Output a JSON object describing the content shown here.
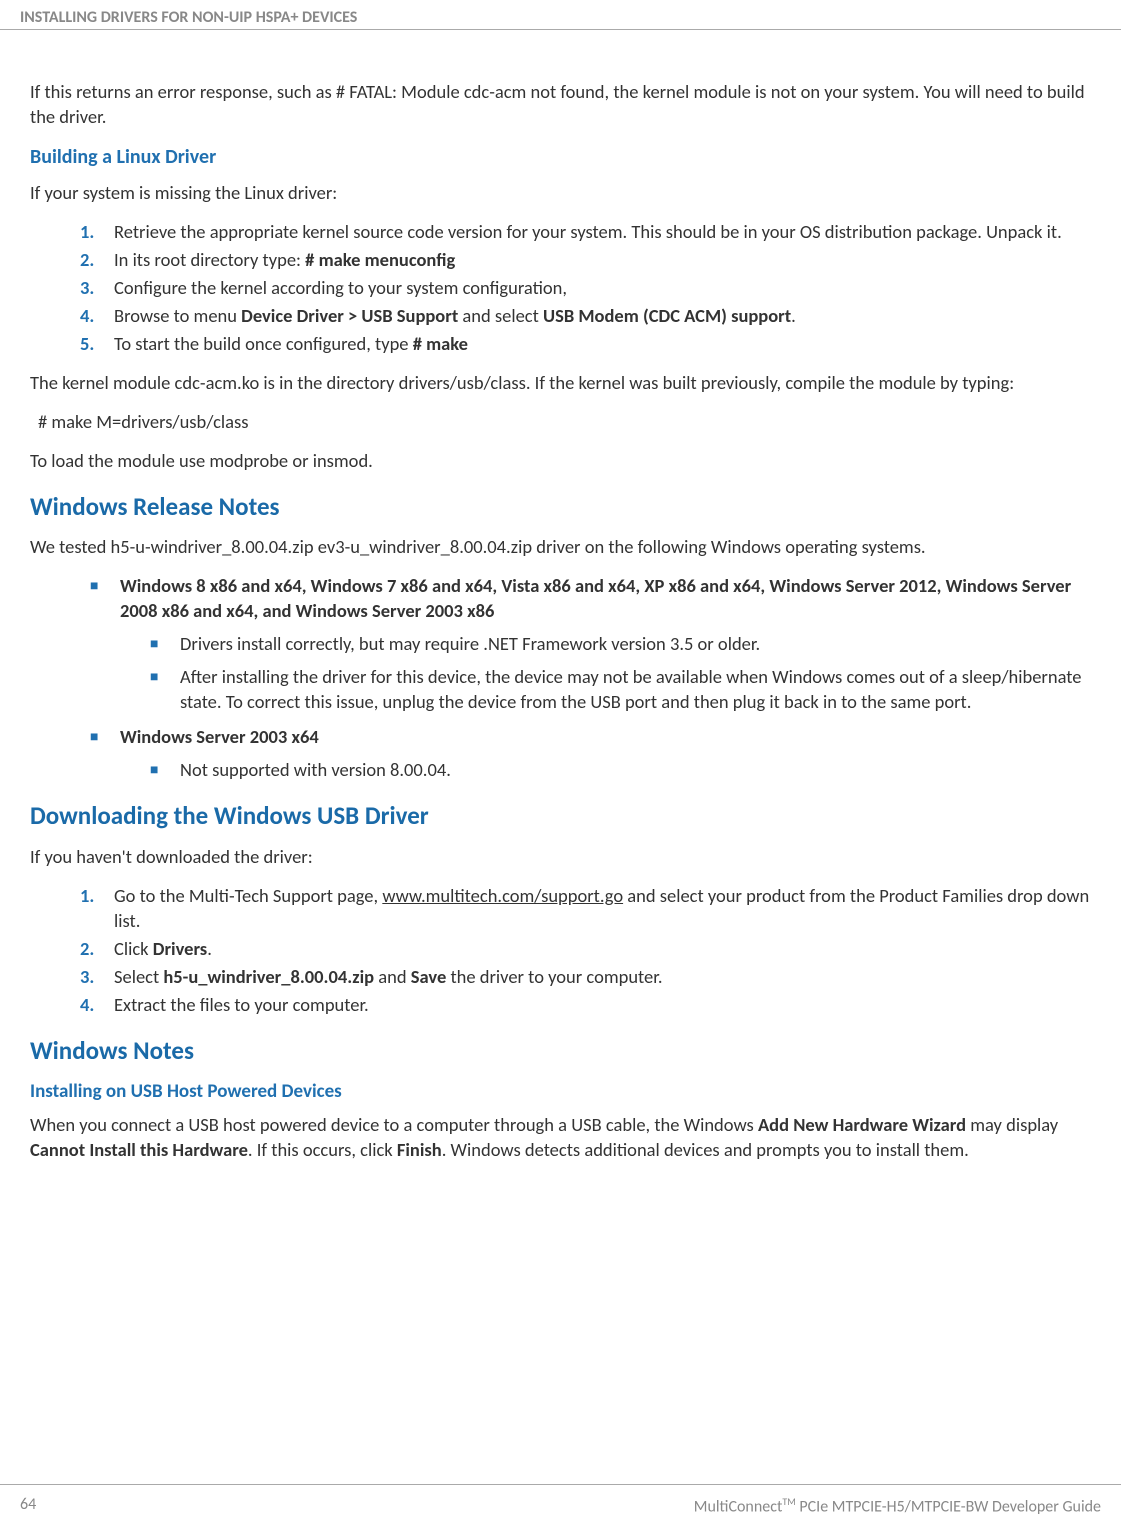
{
  "header": "INSTALLING DRIVERS FOR NON-UIP HSPA+ DEVICES",
  "intro_para": "If this returns an error response, such as # FATAL: Module cdc-acm not found, the kernel module is not on your system. You will need to build the driver.",
  "building_heading": "Building a Linux Driver",
  "building_intro": "If your system is missing the Linux driver:",
  "building_steps": {
    "s1": "Retrieve the appropriate kernel source code version for your system. This should be in your OS distribution package. Unpack it.",
    "s2_a": "In its root directory type: ",
    "s2_b": "# make menuconfig",
    "s3": "Configure the kernel according to your system configuration,",
    "s4_a": "Browse to menu ",
    "s4_b": "Device Driver > USB Support",
    "s4_c": " and select ",
    "s4_d": "USB Modem (CDC ACM) support",
    "s4_e": ".",
    "s5_a": "To start the build once configured, type ",
    "s5_b": "# make"
  },
  "kernel_para": "The kernel module cdc-acm.ko is in the directory drivers/usb/class. If the kernel was built previously, compile the module by typing:",
  "make_cmd": "#  make  M=drivers/usb/class",
  "load_para": "To load the module use modprobe or insmod.",
  "win_notes_heading": "Windows Release Notes",
  "win_notes_intro": "We tested h5-u-windriver_8.00.04.zip ev3-u_windriver_8.00.04.zip driver on the following Windows operating systems.",
  "win_list": {
    "item1": "Windows 8 x86 and x64, Windows 7 x86 and x64, Vista x86 and x64, XP x86 and x64, Windows Server 2012, Windows Server 2008 x86 and x64, and Windows Server 2003 x86",
    "item1_sub1": "Drivers install correctly, but may require .NET Framework version 3.5 or older.",
    "item1_sub2": "After installing the driver for this device, the device may not be available when Windows comes out of a sleep/hibernate state. To correct this issue, unplug the device from the USB port and then plug it back in to the same port.",
    "item2": "Windows Server 2003 x64",
    "item2_sub1": "Not supported with version 8.00.04."
  },
  "download_heading": "Downloading the Windows USB Driver",
  "download_intro": "If you haven't downloaded the driver:",
  "download_steps": {
    "s1_a": "Go to the Multi-Tech Support page, ",
    "s1_b": "www.multitech.com/support.go",
    "s1_c": " and select your product from the Product Families drop down list.",
    "s2_a": "Click ",
    "s2_b": "Drivers",
    "s2_c": ".",
    "s3_a": "Select ",
    "s3_b": "h5-u_windriver_8.00.04.zip",
    "s3_c": " and ",
    "s3_d": "Save",
    "s3_e": " the driver to your computer.",
    "s4": "Extract the files to your computer."
  },
  "win_notes2_heading": "Windows Notes",
  "usb_host_heading": "Installing on USB Host Powered Devices",
  "usb_host_para_a": "When you connect a USB host powered device to a computer through a USB cable, the Windows ",
  "usb_host_para_b": "Add New Hardware Wizard",
  "usb_host_para_c": " may display ",
  "usb_host_para_d": "Cannot Install this Hardware",
  "usb_host_para_e": ". If this occurs, click ",
  "usb_host_para_f": "Finish",
  "usb_host_para_g": ". Windows detects additional devices and prompts you to install them.",
  "footer": {
    "page": "64",
    "doc_a": "MultiConnect",
    "doc_tm": "TM",
    "doc_b": " PCIe MTPCIE-H5/MTPCIE-BW Developer Guide"
  }
}
